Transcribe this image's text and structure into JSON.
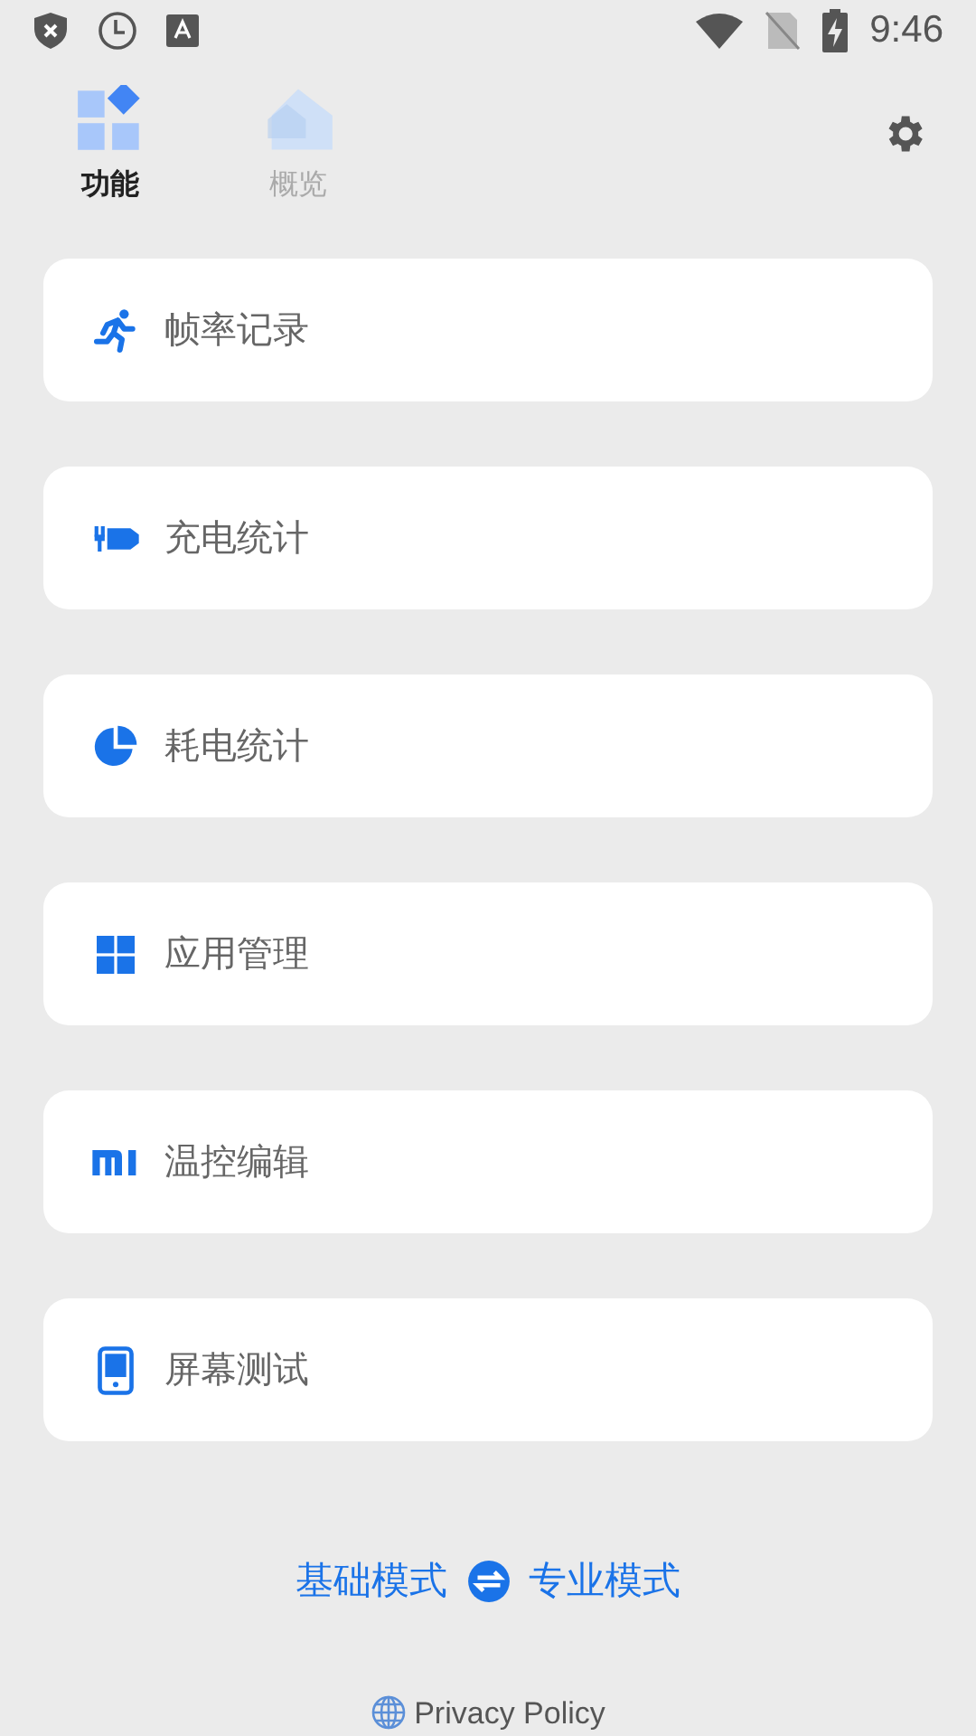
{
  "status_bar": {
    "time": "9:46"
  },
  "tabs": [
    {
      "label": "功能",
      "selected": true
    },
    {
      "label": "概览",
      "selected": false
    }
  ],
  "features": [
    {
      "label": "帧率记录"
    },
    {
      "label": "充电统计"
    },
    {
      "label": "耗电统计"
    },
    {
      "label": "应用管理"
    },
    {
      "label": "温控编辑"
    },
    {
      "label": "屏幕测试"
    }
  ],
  "mode_switch": {
    "left": "基础模式",
    "right": "专业模式"
  },
  "footer": {
    "link": "Privacy Policy"
  }
}
